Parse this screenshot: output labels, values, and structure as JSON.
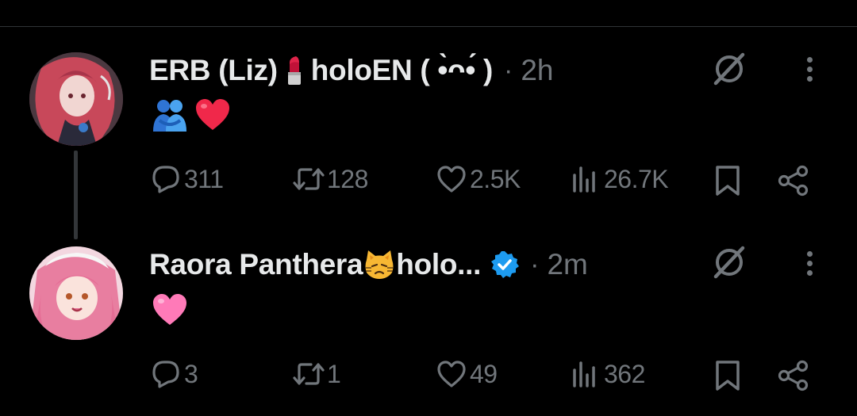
{
  "posts": [
    {
      "author": "ERB (Liz)",
      "name_emoji": "lipstick-emoji",
      "name_suffix": "holoEN ( •̀ᴖ•́ )",
      "separator": "·",
      "time": "2h",
      "body_emojis": [
        "people-hugging-emoji",
        "red-heart-emoji"
      ],
      "verified": false,
      "stats": {
        "replies": "311",
        "reposts": "128",
        "likes": "2.5K",
        "views": "26.7K"
      }
    },
    {
      "author": "Raora Panthera",
      "name_emoji": "cat-face-emoji",
      "name_suffix": "holo...",
      "separator": "·",
      "time": "2m",
      "body_emojis": [
        "pink-heart-emoji"
      ],
      "verified": true,
      "stats": {
        "replies": "3",
        "reposts": "1",
        "likes": "49",
        "views": "362"
      }
    }
  ],
  "colors": {
    "background": "#000000",
    "text": "#e7e9ea",
    "muted": "#71767b",
    "verified": "#1d9bf0",
    "divider": "#2f3336"
  }
}
